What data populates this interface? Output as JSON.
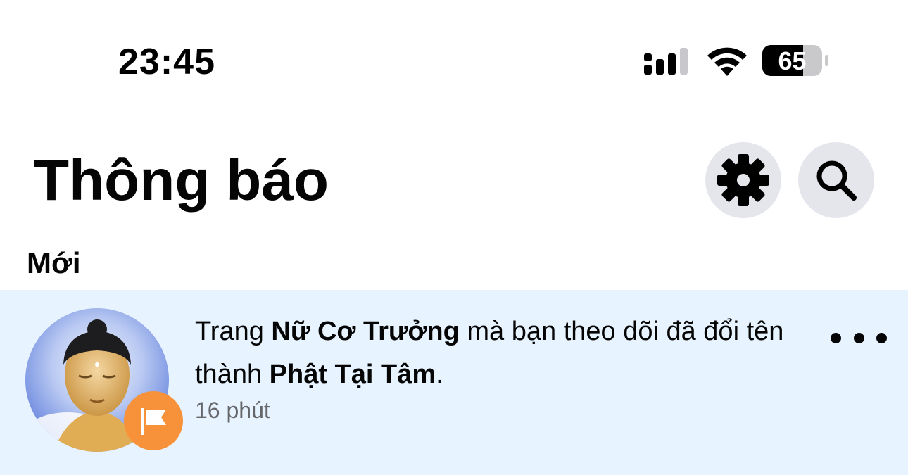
{
  "status_bar": {
    "time": "23:45",
    "battery": "65"
  },
  "header": {
    "title": "Thông báo"
  },
  "section": {
    "label": "Mới"
  },
  "notification": {
    "prefix": "Trang ",
    "old_name": "Nữ Cơ Trưởng",
    "middle": " mà bạn theo dõi đã đổi tên thành ",
    "new_name": "Phật Tại Tâm",
    "suffix": ".",
    "time": "16 phút",
    "badge_icon": "flag-icon"
  },
  "icons": {
    "settings": "gear-icon",
    "search": "search-icon",
    "more": "more-options-icon"
  },
  "colors": {
    "unread_background": "#e7f3ff",
    "badge": "#f7923a",
    "button_background": "#e4e6eb",
    "secondary_text": "#65676b"
  }
}
